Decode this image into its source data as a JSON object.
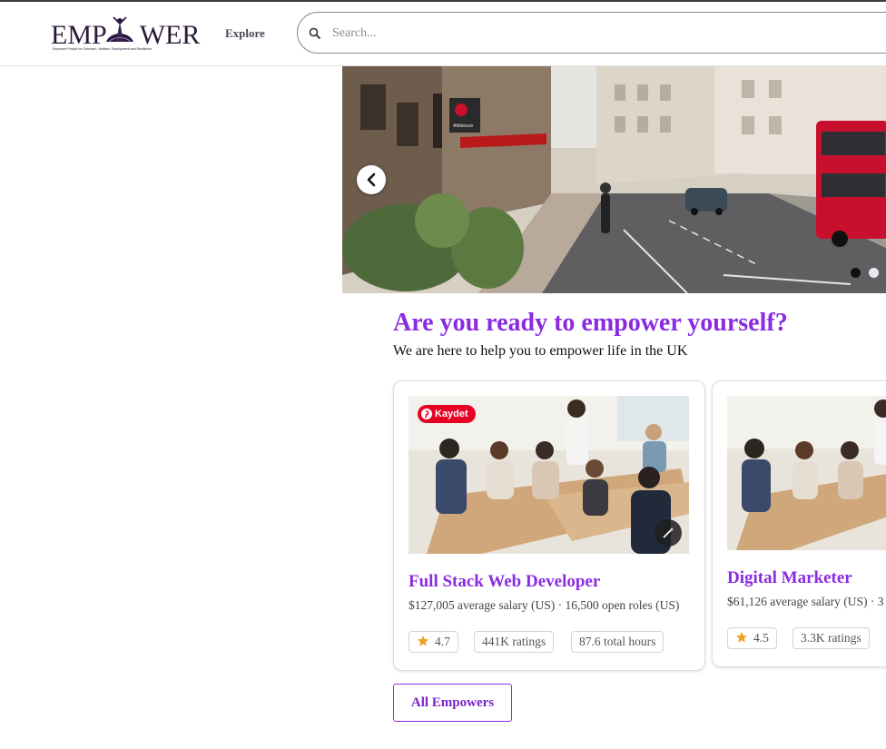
{
  "header": {
    "logo_text_left": "EMP",
    "logo_text_right": "WER",
    "logo_tagline": "Empower People for Outreach, Welfare, Employment and Resilience",
    "nav_explore": "Explore",
    "search_placeholder": "Search..."
  },
  "hero": {
    "slide_count": 2,
    "active_slide": 0,
    "shop_sign": "Athleisure"
  },
  "intro": {
    "headline": "Are you ready to empower yourself?",
    "subline": "We are here to help you to empower life in the UK"
  },
  "cards": [
    {
      "pin_label": "Kaydet",
      "title": "Full Stack Web Developer",
      "meta": "$127,005 average salary (US) · 16,500 open roles (US)",
      "rating": "4.7",
      "ratings_count": "441K ratings",
      "hours": "87.6 total hours"
    },
    {
      "title": "Digital Marketer",
      "meta": "$61,126 average salary (US) · 3",
      "rating": "4.5",
      "ratings_count": "3.3K ratings"
    }
  ],
  "actions": {
    "all_empowers": "All Empowers"
  },
  "colors": {
    "accent_purple": "#8a2be2",
    "pinterest_red": "#e60023",
    "star": "#f0a01e",
    "bus_red": "#c8102e"
  }
}
